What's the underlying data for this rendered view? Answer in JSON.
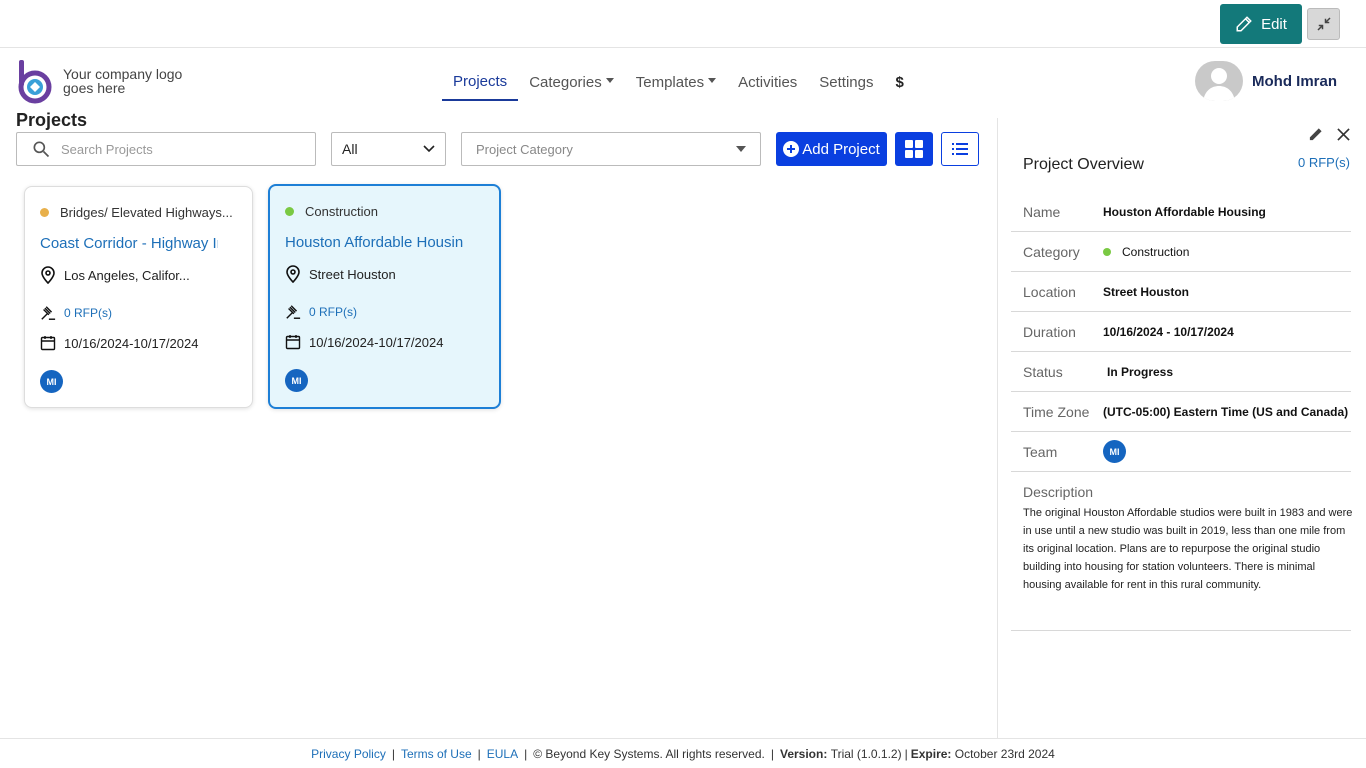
{
  "topbar": {
    "edit_label": "Edit"
  },
  "header": {
    "logo_text": "Your company logo goes here",
    "nav": [
      {
        "label": "Projects",
        "active": true
      },
      {
        "label": "Categories"
      },
      {
        "label": "Templates"
      },
      {
        "label": "Activities"
      },
      {
        "label": "Settings"
      },
      {
        "label": "$"
      }
    ],
    "user_name": "Mohd Imran"
  },
  "page": {
    "title": "Projects"
  },
  "toolbar": {
    "search_placeholder": "Search Projects",
    "status_filter": "All",
    "category_placeholder": "Project Category",
    "add_label": "Add Project"
  },
  "cards": [
    {
      "category": "Bridges/ Elevated Highways...",
      "category_color": "#e8b04b",
      "title": "Coast Corridor - Highway Im",
      "location": "Los Angeles, Califor...",
      "rfps": "0 RFP(s)",
      "dates": "10/16/2024-10/17/2024",
      "member": "MI"
    },
    {
      "category": "Construction",
      "category_color": "#7ac943",
      "title": "Houston Affordable Housing",
      "location": "Street Houston",
      "rfps": "0 RFP(s)",
      "dates": "10/16/2024-10/17/2024",
      "member": "MI"
    }
  ],
  "overview": {
    "title": "Project Overview",
    "rfps": "0 RFP(s)",
    "rows": {
      "name_label": "Name",
      "name": "Houston Affordable Housing",
      "category_label": "Category",
      "category": "Construction",
      "location_label": "Location",
      "location": "Street Houston",
      "duration_label": "Duration",
      "duration": "10/16/2024 - 10/17/2024",
      "status_label": "Status",
      "status": "In Progress",
      "timezone_label": "Time Zone",
      "timezone": "(UTC-05:00) Eastern Time (US and Canada)",
      "team_label": "Team",
      "team_member": "MI"
    },
    "description_label": "Description",
    "description": "The original Houston Affordable studios were built in 1983 and were in use until a new studio was built in 2019, less than one mile from its original location. Plans are to repurpose the original studio building into housing for station volunteers. There is minimal housing available for rent in this rural community."
  },
  "footer": {
    "privacy": "Privacy Policy",
    "terms": "Terms of Use",
    "eula": "EULA",
    "copyright": "© Beyond Key Systems. All rights reserved.",
    "version_label": "Version:",
    "version": "Trial (1.0.1.2)",
    "expire_label": "Expire:",
    "expire": "October 23rd 2024"
  }
}
